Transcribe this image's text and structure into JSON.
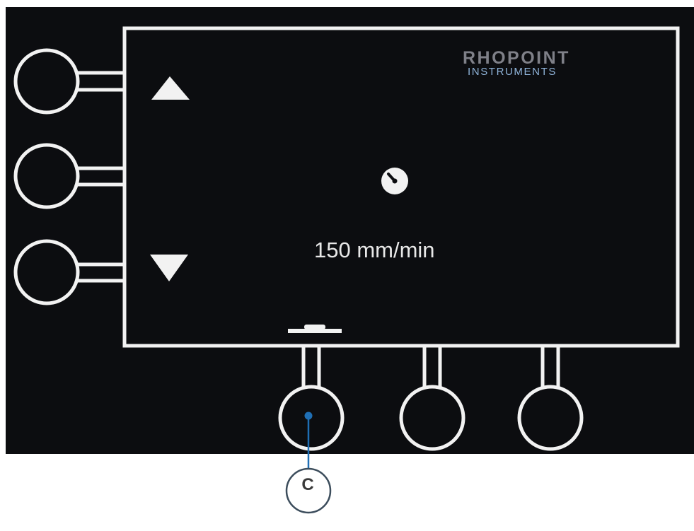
{
  "brand": {
    "line1": "RHOPOINT",
    "line2": "INSTRUMENTS",
    "color_primary": "#7f8088",
    "color_secondary": "#8fb3d9"
  },
  "display": {
    "speed_value": "150 mm/min",
    "status_icon": "gauge-icon"
  },
  "soft_keys": {
    "left": [
      "up-arrow-icon",
      "",
      "down-arrow-icon"
    ],
    "bottom": [
      "tab-indicator",
      "",
      ""
    ]
  },
  "callout": {
    "label": "C",
    "color": "#1f6fb5"
  }
}
